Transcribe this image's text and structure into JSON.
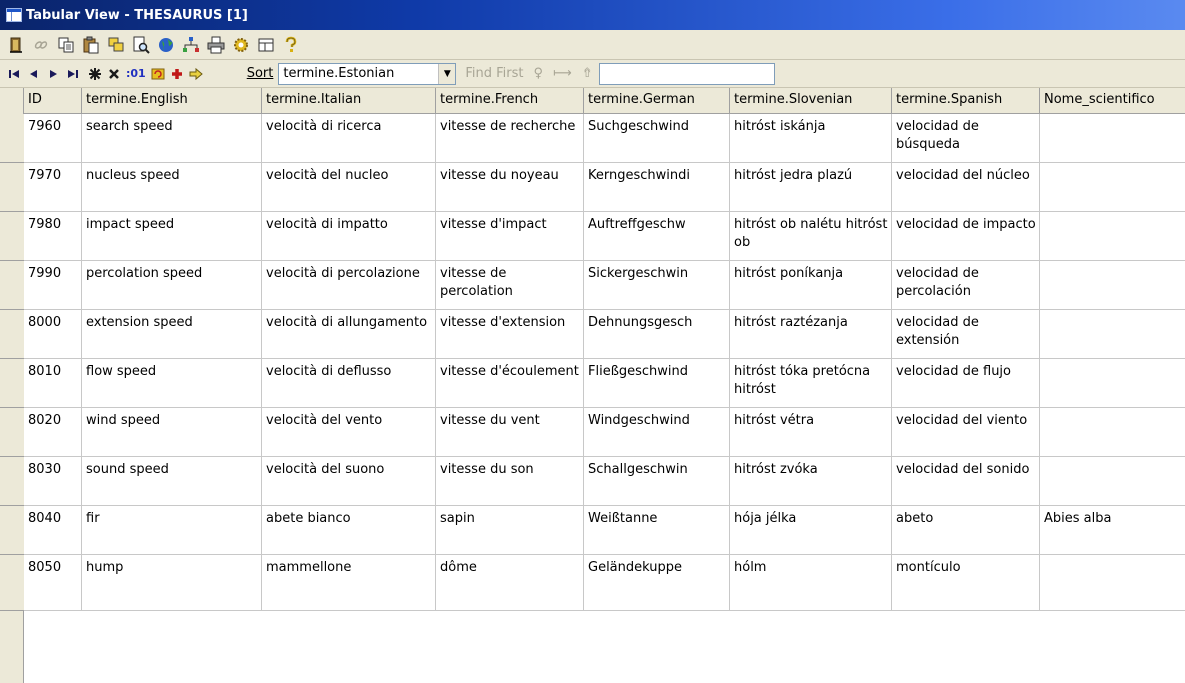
{
  "window": {
    "title": "Tabular View - THESAURUS [1]"
  },
  "toolbar": {
    "icons": [
      "exit-icon",
      "link-icon",
      "copy-icon",
      "paste-icon",
      "duplicate-icon",
      "print-preview-icon",
      "globe-icon",
      "network-icon",
      "print-icon",
      "settings-icon",
      "layout-icon",
      "help-icon"
    ]
  },
  "nav": {
    "counter_label": ":01",
    "sort_label": "Sort",
    "sort_value": "termine.Estonian",
    "find_first": "Find First",
    "find_value": ""
  },
  "table": {
    "columns": [
      "ID",
      "termine.English",
      "termine.Italian",
      "termine.French",
      "termine.German",
      "termine.Slovenian",
      "termine.Spanish",
      "Nome_scientifico"
    ],
    "rows": [
      [
        "7960",
        "search speed",
        "velocità di ricerca",
        "vitesse de recherche",
        "Suchgeschwind",
        "hitróst iskánja",
        "velocidad de búsqueda",
        ""
      ],
      [
        "7970",
        "nucleus speed",
        "velocità del nucleo",
        "vitesse du noyeau",
        "Kerngeschwindi",
        "hitróst jedra plazú",
        "velocidad del núcleo",
        ""
      ],
      [
        "7980",
        "impact speed",
        "velocità di impatto",
        "vitesse d'impact",
        "Auftreffgeschw",
        "hitróst ob nalétu hitróst ob",
        "velocidad de impacto",
        ""
      ],
      [
        "7990",
        "percolation speed",
        "velocità di percolazione",
        "vitesse de percolation",
        "Sickergeschwin",
        "hitróst poníkanja",
        "velocidad de percolación",
        ""
      ],
      [
        "8000",
        "extension speed",
        "velocità di allungamento",
        "vitesse d'extension",
        "Dehnungsgesch",
        "hitróst raztézanja",
        "velocidad de extensión",
        ""
      ],
      [
        "8010",
        "flow speed",
        "velocità di deflusso",
        "vitesse d'écoulement",
        "Fließgeschwind",
        "hitróst tóka pretócna hitróst",
        "velocidad de flujo",
        ""
      ],
      [
        "8020",
        "wind speed",
        "velocità del vento",
        "vitesse du vent",
        "Windgeschwind",
        "hitróst vétra",
        "velocidad del viento",
        ""
      ],
      [
        "8030",
        "sound speed",
        "velocità del suono",
        "vitesse du son",
        "Schallgeschwin",
        "hitróst zvóka",
        "velocidad del sonido",
        ""
      ],
      [
        "8040",
        "fir",
        "abete bianco",
        "sapin",
        "Weißtanne",
        "hója jélka",
        "abeto",
        "Abies alba"
      ],
      [
        "8050",
        "hump",
        "mammellone",
        "dôme",
        "Geländekuppe",
        "hólm",
        "montículo",
        ""
      ]
    ]
  }
}
